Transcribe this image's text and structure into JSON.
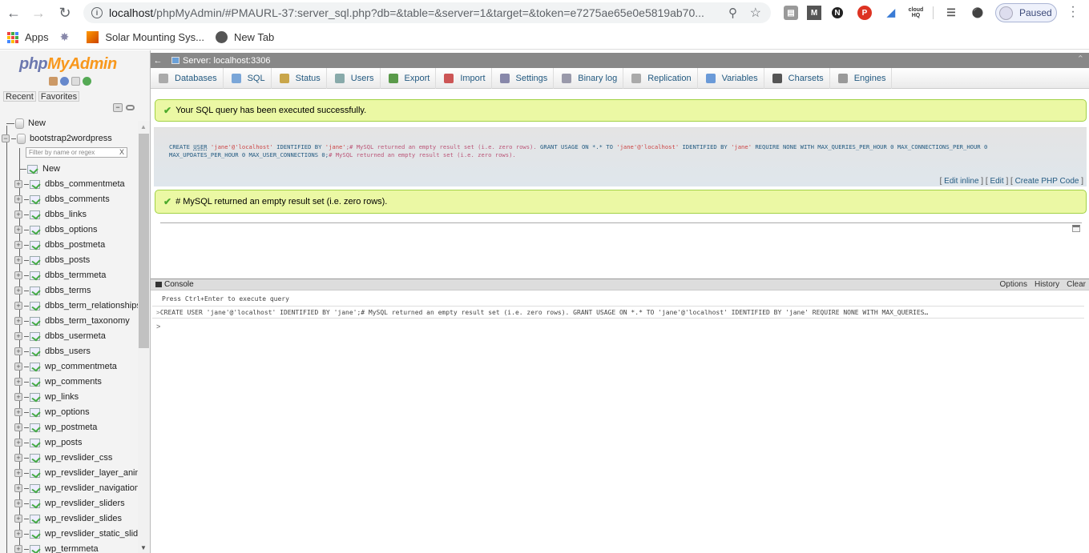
{
  "browser": {
    "url_host": "localhost",
    "url_rest": "/phpMyAdmin/#PMAURL-37:server_sql.php?db=&table=&server=1&target=&token=e7275ae65e0e5819ab70...",
    "profile_status": "Paused",
    "bookmarks": [
      {
        "label": "Apps",
        "icon": "apps-grid-icon"
      },
      {
        "label": "",
        "icon": "bookmark-app-icon"
      },
      {
        "label": "Solar Mounting Sys...",
        "icon": "solar-icon"
      },
      {
        "label": "New Tab",
        "icon": "globe-icon"
      }
    ],
    "extensions": [
      "tab-extension-icon",
      "m-extension-icon",
      "n-extension-icon",
      "pinterest-icon",
      "tag-extension-icon",
      "cloudhq-icon",
      "media-icon",
      "key-icon"
    ]
  },
  "nav": {
    "logo_php": "php",
    "logo_myadmin": "MyAdmin",
    "recent_label": "Recent",
    "favorites_label": "Favorites",
    "new_label": "New",
    "database": "bootstrap2wordpress",
    "filter_placeholder": "Filter by name or regex",
    "filter_clear": "X",
    "db_new_label": "New",
    "tables": [
      "dbbs_commentmeta",
      "dbbs_comments",
      "dbbs_links",
      "dbbs_options",
      "dbbs_postmeta",
      "dbbs_posts",
      "dbbs_termmeta",
      "dbbs_terms",
      "dbbs_term_relationships",
      "dbbs_term_taxonomy",
      "dbbs_usermeta",
      "dbbs_users",
      "wp_commentmeta",
      "wp_comments",
      "wp_links",
      "wp_options",
      "wp_postmeta",
      "wp_posts",
      "wp_revslider_css",
      "wp_revslider_layer_anima",
      "wp_revslider_navigations",
      "wp_revslider_sliders",
      "wp_revslider_slides",
      "wp_revslider_static_slides",
      "wp_termmeta"
    ]
  },
  "server_bar": {
    "title": "Server: localhost:3306"
  },
  "tabs": [
    {
      "label": "Databases",
      "color": "#aaa"
    },
    {
      "label": "SQL",
      "color": "#7aa6d8"
    },
    {
      "label": "Status",
      "color": "#c9a64a"
    },
    {
      "label": "Users",
      "color": "#8aa"
    },
    {
      "label": "Export",
      "color": "#5a9a4a"
    },
    {
      "label": "Import",
      "color": "#c55"
    },
    {
      "label": "Settings",
      "color": "#88a"
    },
    {
      "label": "Binary log",
      "color": "#99a"
    },
    {
      "label": "Replication",
      "color": "#aaa"
    },
    {
      "label": "Variables",
      "color": "#6a9ad8"
    },
    {
      "label": "Charsets",
      "color": "#555"
    },
    {
      "label": "Engines",
      "color": "#999"
    }
  ],
  "messages": {
    "success": "Your SQL query has been executed successfully.",
    "result": "# MySQL returned an empty result set (i.e. zero rows)."
  },
  "sql": {
    "line1_a": "CREATE ",
    "line1_user": "USER",
    "line1_str1": " 'jane'@'localhost' ",
    "line1_kw": "IDENTIFIED BY ",
    "line1_str2": "'jane'",
    "line1_cm": ";# MySQL returned an empty result set (i.e. zero rows). ",
    "line1_kw2": "GRANT USAGE ON *.* TO ",
    "line1_str3": "'jane'@'localhost' ",
    "line1_kw3": "IDENTIFIED BY ",
    "line1_str4": "'jane' ",
    "line1_kw4": "REQUIRE NONE WITH MAX_QUERIES_PER_HOUR 0 MAX_CONNECTIONS_PER_HOUR 0",
    "line2_kw": "MAX_UPDATES_PER_HOUR 0 MAX_USER_CONNECTIONS 0;",
    "line2_cm": "# MySQL returned an empty result set (i.e. zero rows).",
    "edit_inline": "Edit inline",
    "edit": "Edit",
    "create_php": "Create PHP Code"
  },
  "console": {
    "title": "Console",
    "options": "Options",
    "history": "History",
    "clear": "Clear",
    "hint": "Press Ctrl+Enter to execute query",
    "query": "CREATE USER 'jane'@'localhost' IDENTIFIED BY 'jane';# MySQL returned an empty result set (i.e. zero rows). GRANT USAGE ON *.* TO 'jane'@'localhost' IDENTIFIED BY 'jane' REQUIRE NONE WITH MAX_QUERIES…",
    "prompt": ">"
  }
}
